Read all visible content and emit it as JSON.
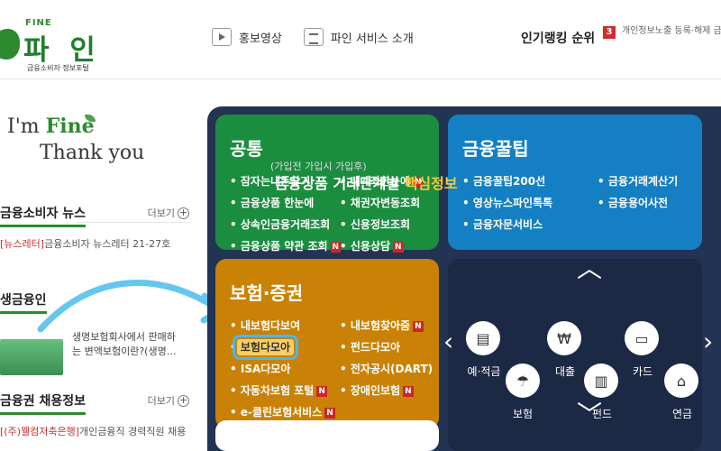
{
  "header": {
    "logo_fine": "FINE",
    "logo_korean": "파 인",
    "logo_subtitle": "금융소비자 정보포털",
    "nav": [
      {
        "label": "홍보영상",
        "icon": "play-icon"
      },
      {
        "label": "파인 서비스 소개",
        "icon": "document-icon"
      }
    ],
    "ranking_title": "인기랭킹 순위",
    "ranking_num": "3",
    "ranking_text": "개인정보노출 등록·해제 금융상품 한눈에"
  },
  "left": {
    "im": "I'm",
    "fine": "Fine",
    "thank": "Thank you",
    "news_title": "금융소비자 뉴스",
    "more": "더보기",
    "news_tag": "[뉴스레터]",
    "news_item": "금융소비자 뉴스레터 21-27호",
    "life_title": "생금융인",
    "life_text1": "생명보험회사에서 판매하",
    "life_text2": "는 변액보험이란?(생명…",
    "job_title": "금융권 채용정보",
    "job_tag": "[(주)웰컴저축은행]",
    "job_item": "개인금융직 경력직원 채용"
  },
  "boxes": {
    "common": {
      "title": "공통",
      "items": [
        "잠자는내돈찾기",
        "내계좌한눈에",
        "금융상품 한눈에",
        "채권자변동조회",
        "상속인금융거래조회",
        "신용정보조회",
        "금융상품 약관 조회",
        "신용상담"
      ]
    },
    "tips": {
      "title": "금융꿀팁",
      "items": [
        "금융꿀팁200선",
        "금융거래계산기",
        "영상뉴스파인톡톡",
        "금융용어사전",
        "금융자문서비스"
      ]
    },
    "insurance": {
      "title": "보험·증권",
      "items": [
        "내보험다보여",
        "내보험찾아줌",
        "보험다모아",
        "펀드다모아",
        "ISA다모아",
        "전자공시(DART)",
        "자동차보험 포털",
        "장애인보험",
        "e-클린보험서비스"
      ]
    }
  },
  "core": {
    "line1": "(가입전 가입시 가입후)",
    "line2a": "금융상품 거래단계별 ",
    "line2b": "핵심정보",
    "items": [
      "예·적금",
      "대출",
      "카드",
      "보험",
      "펀드",
      "연금"
    ]
  },
  "colors": {
    "green": "#1b8d3f",
    "blue": "#157fc3",
    "orange": "#c98205",
    "navy": "#233353"
  }
}
